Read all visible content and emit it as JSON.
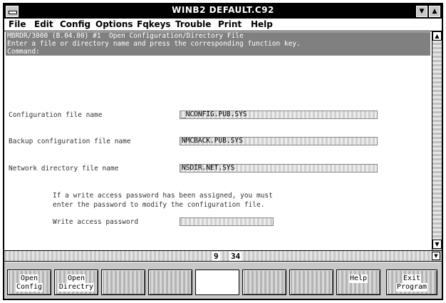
{
  "window": {
    "title": "WINB2 DEFAULT.C92"
  },
  "menu": [
    "File",
    "Edit",
    "Config",
    "Options",
    "Fqkeys",
    "Trouble",
    "Print",
    "Help"
  ],
  "header": {
    "line1": "MBRDR/3000 (B.04.00) #1  Open Configuration/Directory File",
    "line2": "Enter a file or directory name and press the corresponding function key.",
    "line3": "Command:"
  },
  "fields": {
    "config_label": "Configuration file name",
    "config_value": "_NCONFIG.PUB.SYS",
    "backup_label": "Backup configuration file name",
    "backup_value": "NMCBACK.PUB.SYS",
    "netdir_label": "Network directory file name",
    "netdir_value": "NSDIR.NET.SYS",
    "note_line1": "If a write access password has been assigned, you must",
    "note_line2": "enter the password to modify the configuration file.",
    "password_label": "Write access password"
  },
  "status": {
    "row": "9",
    "col": "34"
  },
  "fkeys": [
    {
      "line1": "Open",
      "line2": "Config"
    },
    {
      "line1": "Open",
      "line2": "Directry"
    },
    {
      "line1": "",
      "line2": ""
    },
    {
      "line1": "",
      "line2": ""
    },
    {
      "line1": "",
      "line2": ""
    },
    {
      "line1": "",
      "line2": ""
    },
    {
      "line1": "",
      "line2": ""
    },
    {
      "line1": "Help",
      "line2": ""
    },
    {
      "line1": "Exit",
      "line2": "Program"
    }
  ]
}
